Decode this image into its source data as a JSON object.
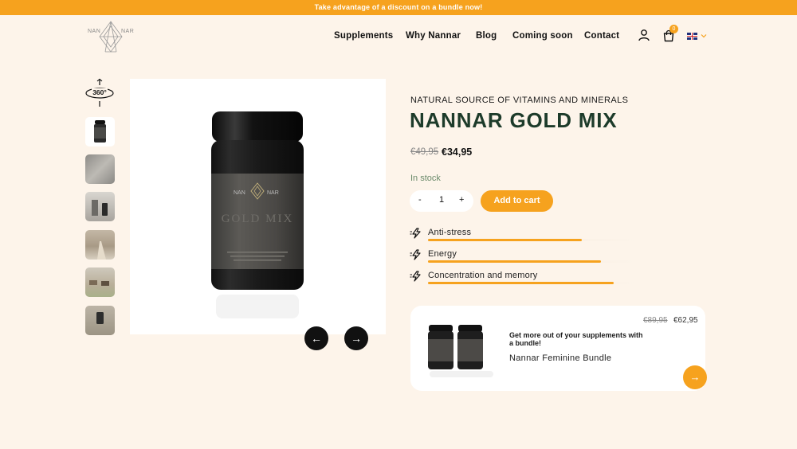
{
  "banner": {
    "text": "Take advantage of a discount on a bundle now!"
  },
  "logo": {
    "left": "NAN",
    "right": "NAR"
  },
  "nav": [
    {
      "label": "Supplements"
    },
    {
      "label": "Why Nannar"
    },
    {
      "label": "Blog"
    },
    {
      "label": "Coming soon"
    },
    {
      "label": "Contact"
    }
  ],
  "header": {
    "cart_count": "0",
    "language_icon": "uk-flag-icon"
  },
  "gallery": {
    "rotate_label": "360°",
    "thumbnails": [
      "jar",
      "label-close-up",
      "jar-and-box",
      "lifestyle-path",
      "horses",
      "outdoor-jar"
    ],
    "jar_brand_left": "NAN",
    "jar_brand_right": "NAR",
    "jar_product_text": "GOLD MIX",
    "prev_icon": "arrow-left-icon",
    "next_icon": "arrow-right-icon"
  },
  "product": {
    "subtitle": "NATURAL SOURCE OF VITAMINS AND MINERALS",
    "title": "NANNAR GOLD MIX",
    "old_price": "€49,95",
    "price": "€34,95",
    "stock": "In stock",
    "qty_minus": "-",
    "qty_value": "1",
    "qty_plus": "+",
    "add_to_cart": "Add to cart"
  },
  "benefits": [
    {
      "label": "Anti-stress",
      "level": 0.73
    },
    {
      "label": "Energy",
      "level": 0.82
    },
    {
      "label": "Concentration and memory",
      "level": 0.88
    }
  ],
  "bundle": {
    "old_price": "€89,95",
    "price": "€62,95",
    "headline": "Get more out of your supplements with a bundle!",
    "name": "Nannar Feminine Bundle",
    "arrow_icon": "arrow-right-icon"
  },
  "colors": {
    "accent": "#f6a21e",
    "title": "#1d3b2a",
    "background": "#fdf4ea"
  }
}
